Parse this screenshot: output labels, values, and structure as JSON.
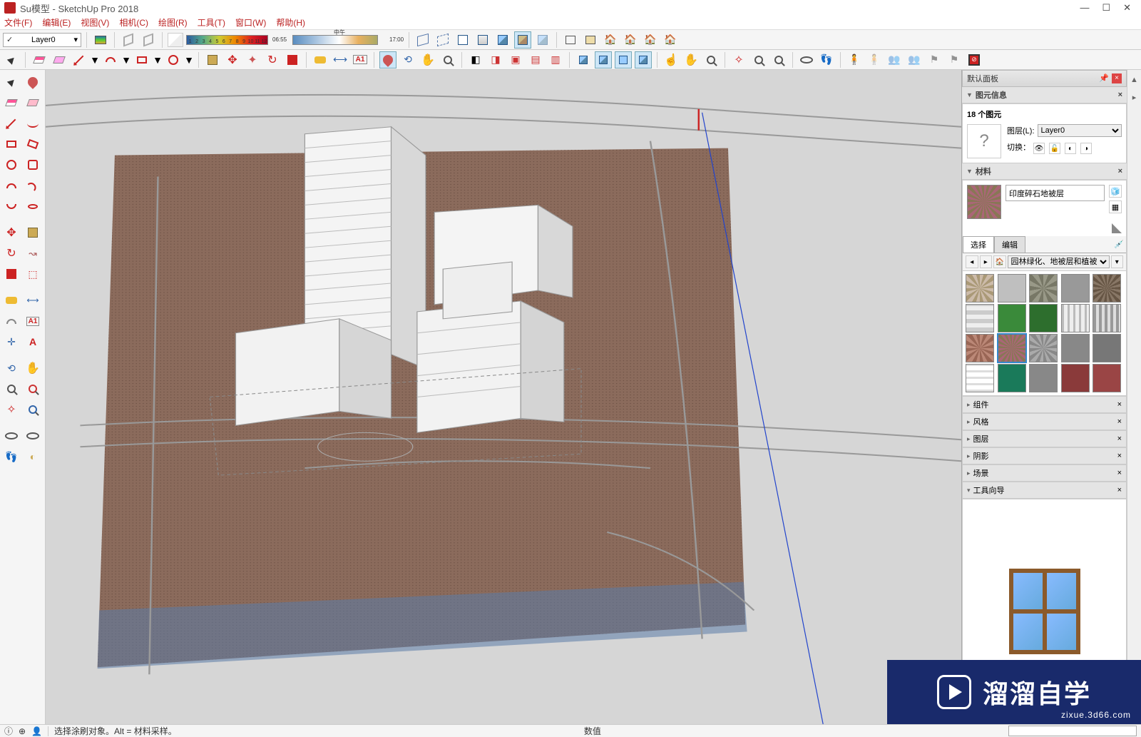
{
  "title": "Su模型 - SketchUp Pro 2018",
  "menu": [
    "文件(F)",
    "编辑(E)",
    "视图(V)",
    "相机(C)",
    "绘图(R)",
    "工具(T)",
    "窗口(W)",
    "帮助(H)"
  ],
  "layer_dropdown": "Layer0",
  "gradient_labels": [
    "1",
    "2",
    "3",
    "4",
    "5",
    "6",
    "7",
    "8",
    "9",
    "10",
    "11",
    "12"
  ],
  "time_start": "06:55",
  "time_mid": "中午",
  "time_end": "17:00",
  "panels": {
    "tray_title": "默认面板",
    "entity": {
      "header": "图元信息",
      "count": "18 个图元",
      "layer_lbl": "图层(L):",
      "layer_val": "Layer0",
      "toggle_lbl": "切换："
    },
    "materials": {
      "header": "材料",
      "name": "印度碎石地被层",
      "tab_select": "选择",
      "tab_edit": "编辑",
      "lib": "园林绿化、地被层和植被"
    },
    "collapsed": [
      "组件",
      "风格",
      "图层",
      "阴影",
      "场景"
    ],
    "guide": "工具向导"
  },
  "status": {
    "hint": "选择涂刷对象。Alt = 材料采样。",
    "value_lbl": "数值"
  },
  "watermark": {
    "text": "溜溜自学",
    "sub": "zixue.3d66.com"
  }
}
